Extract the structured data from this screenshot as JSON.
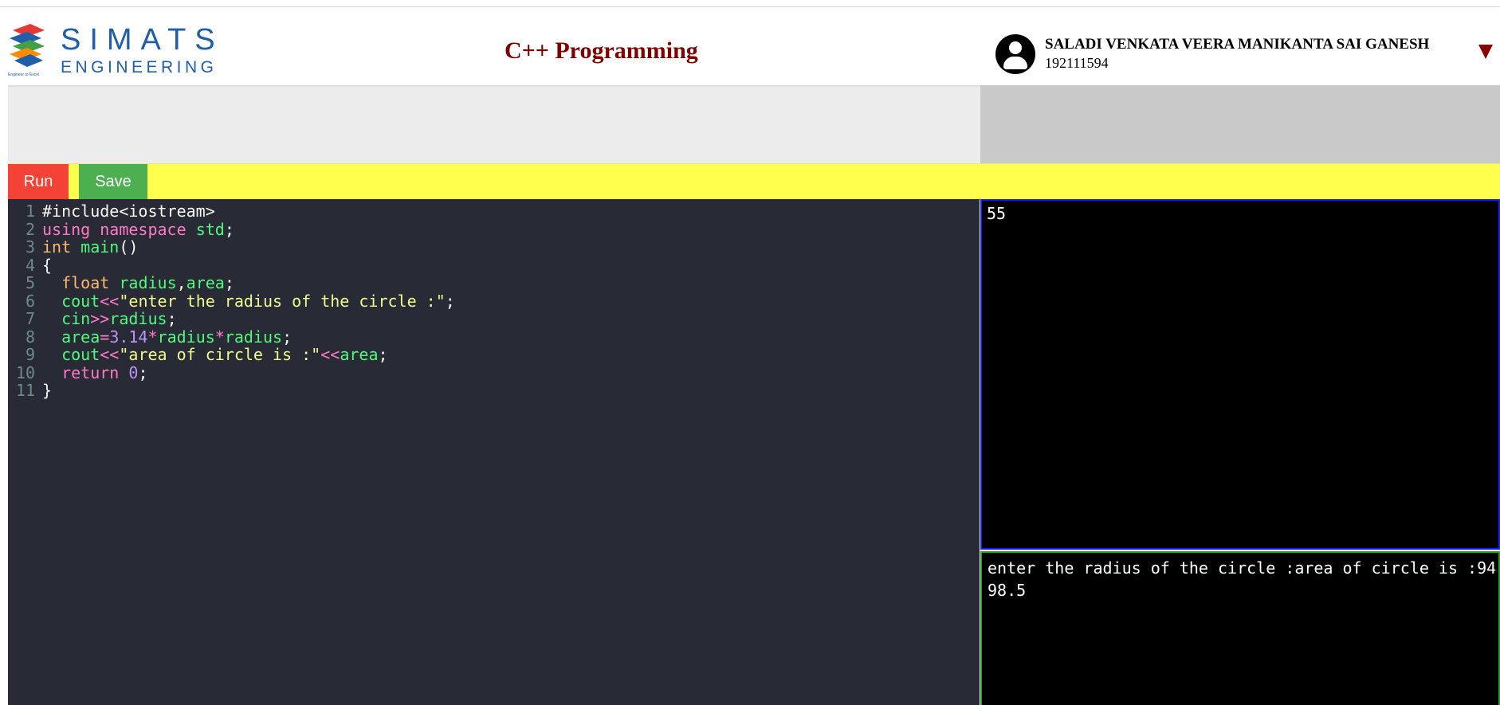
{
  "header": {
    "logo": {
      "brand": "SIMATS",
      "sub": "ENGINEERING",
      "tagline": "Engineer to Excel"
    },
    "title": "C++ Programming",
    "user": {
      "name": "SALADI VENKATA VEERA MANIKANTA SAI GANESH",
      "id": "192111594"
    }
  },
  "toolbar": {
    "run_label": "Run",
    "save_label": "Save"
  },
  "editor": {
    "line_numbers": [
      "1",
      "2",
      "3",
      "4",
      "5",
      "6",
      "7",
      "8",
      "9",
      "10",
      "11"
    ],
    "lines": [
      [
        {
          "t": "#include<iostream>",
          "c": "pre"
        }
      ],
      [
        {
          "t": "using",
          "c": "kw"
        },
        {
          "t": " ",
          "c": "pl"
        },
        {
          "t": "namespace",
          "c": "kw"
        },
        {
          "t": " ",
          "c": "pl"
        },
        {
          "t": "std",
          "c": "var"
        },
        {
          "t": ";",
          "c": "pl"
        }
      ],
      [
        {
          "t": "int",
          "c": "type"
        },
        {
          "t": " ",
          "c": "pl"
        },
        {
          "t": "main",
          "c": "fn"
        },
        {
          "t": "()",
          "c": "pl"
        }
      ],
      [
        {
          "t": "{",
          "c": "pl"
        }
      ],
      [
        {
          "t": "  ",
          "c": "pl"
        },
        {
          "t": "float",
          "c": "type"
        },
        {
          "t": " ",
          "c": "pl"
        },
        {
          "t": "radius",
          "c": "var"
        },
        {
          "t": ",",
          "c": "pl"
        },
        {
          "t": "area",
          "c": "var"
        },
        {
          "t": ";",
          "c": "pl"
        }
      ],
      [
        {
          "t": "  ",
          "c": "pl"
        },
        {
          "t": "cout",
          "c": "var"
        },
        {
          "t": "<<",
          "c": "op"
        },
        {
          "t": "\"enter the radius of the circle :\"",
          "c": "str"
        },
        {
          "t": ";",
          "c": "pl"
        }
      ],
      [
        {
          "t": "  ",
          "c": "pl"
        },
        {
          "t": "cin",
          "c": "var"
        },
        {
          "t": ">>",
          "c": "op"
        },
        {
          "t": "radius",
          "c": "var"
        },
        {
          "t": ";",
          "c": "pl"
        }
      ],
      [
        {
          "t": "  ",
          "c": "pl"
        },
        {
          "t": "area",
          "c": "var"
        },
        {
          "t": "=",
          "c": "op"
        },
        {
          "t": "3.14",
          "c": "num"
        },
        {
          "t": "*",
          "c": "op"
        },
        {
          "t": "radius",
          "c": "var"
        },
        {
          "t": "*",
          "c": "op"
        },
        {
          "t": "radius",
          "c": "var"
        },
        {
          "t": ";",
          "c": "pl"
        }
      ],
      [
        {
          "t": "  ",
          "c": "pl"
        },
        {
          "t": "cout",
          "c": "var"
        },
        {
          "t": "<<",
          "c": "op"
        },
        {
          "t": "\"area of circle is :\"",
          "c": "str"
        },
        {
          "t": "<<",
          "c": "op"
        },
        {
          "t": "area",
          "c": "var"
        },
        {
          "t": ";",
          "c": "pl"
        }
      ],
      [
        {
          "t": "  ",
          "c": "pl"
        },
        {
          "t": "return",
          "c": "kw"
        },
        {
          "t": " ",
          "c": "pl"
        },
        {
          "t": "0",
          "c": "num"
        },
        {
          "t": ";",
          "c": "pl"
        }
      ],
      [
        {
          "t": "}",
          "c": "pl"
        }
      ]
    ]
  },
  "input_panel": {
    "text": "55"
  },
  "output_panel": {
    "text": "enter the radius of the circle :area of circle is :9498.5"
  },
  "colors": {
    "run": "#f44336",
    "save": "#4caf50",
    "toolbar": "#ffff4d",
    "editor_bg": "#282a36",
    "title": "#800000",
    "input_border": "#1a1aff",
    "output_border": "#1ea31e"
  }
}
